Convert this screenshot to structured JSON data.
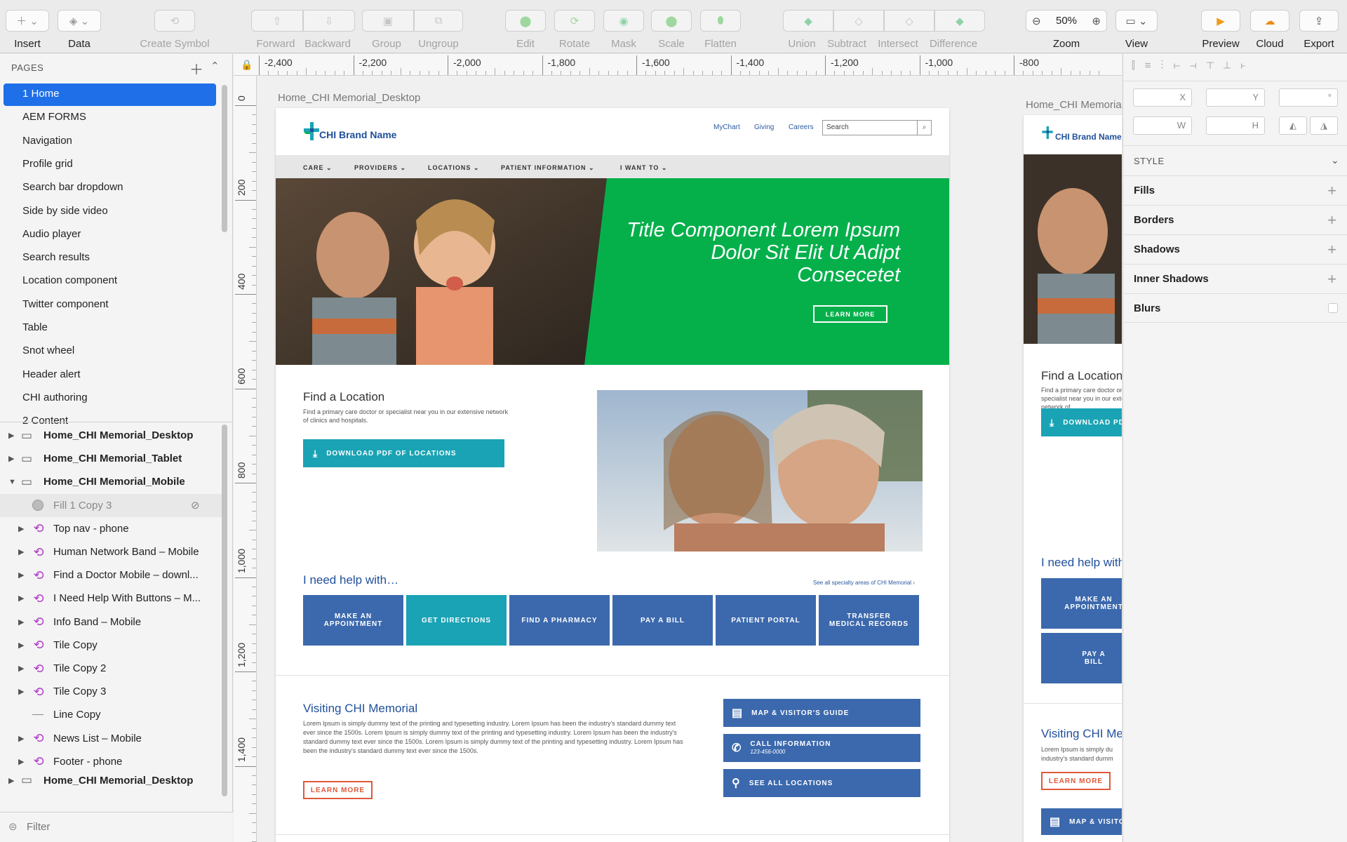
{
  "toolbar": {
    "items": [
      "Insert",
      "Data",
      "Create Symbol",
      "Forward",
      "Backward",
      "Group",
      "Ungroup",
      "Edit",
      "Rotate",
      "Mask",
      "Scale",
      "Flatten",
      "Union",
      "Subtract",
      "Intersect",
      "Difference",
      "Zoom",
      "View",
      "Preview",
      "Cloud",
      "Export"
    ],
    "zoom_value": "50%"
  },
  "pages": {
    "header": "PAGES",
    "items": [
      "1 Home",
      "AEM FORMS",
      "Navigation",
      "Profile grid",
      "Search bar dropdown",
      "Side by side video",
      "Audio player",
      "Search results",
      "Location component",
      "Twitter component",
      "Table",
      "Snot wheel",
      "Header alert",
      "CHI authoring",
      "2 Content"
    ]
  },
  "layers": {
    "artboards": [
      "Home_CHI Memorial_Desktop",
      "Home_CHI Memorial_Tablet",
      "Home_CHI Memorial_Mobile"
    ],
    "children": [
      "Fill 1 Copy 3",
      "Top nav - phone",
      "Human Network Band – Mobile",
      "Find a Doctor Mobile – downl...",
      "I Need Help With Buttons – M...",
      "Info Band – Mobile",
      "Tile  Copy",
      "Tile  Copy 2",
      "Tile  Copy 3",
      "Line Copy",
      "News List – Mobile",
      "Footer - phone"
    ],
    "last_artboard": "Home_CHI Memorial_Desktop",
    "filter_placeholder": "Filter"
  },
  "ruler": {
    "h": [
      "-2,400",
      "-2,200",
      "-2,000",
      "-1,800",
      "-1,600",
      "-1,400",
      "-1,200",
      "-1,000",
      "-800"
    ],
    "v": [
      "0",
      "200",
      "400",
      "600",
      "800",
      "1,000",
      "1,200",
      "1,400"
    ]
  },
  "inspector": {
    "fields": [
      "X",
      "Y",
      "°",
      "W",
      "H"
    ],
    "style_label": "STYLE",
    "sections": [
      "Fills",
      "Borders",
      "Shadows",
      "Inner Shadows",
      "Blurs"
    ]
  },
  "desktop": {
    "artboard_label": "Home_CHI Memorial_Desktop",
    "brand": "CHI Brand Name",
    "util_links": [
      "MyChart",
      "Giving",
      "Careers"
    ],
    "search_placeholder": "Search",
    "nav": [
      "CARE",
      "PROVIDERS",
      "LOCATIONS",
      "PATIENT INFORMATION",
      "I WANT TO"
    ],
    "hero_title": "Title Component Lorem Ipsum Dolor Sit Elit Ut Adipt Consecetet",
    "hero_button": "LEARN MORE",
    "find_title": "Find a Location",
    "find_text": "Find a primary care doctor or specialist near you in our extensive network of clinics and hospitals.",
    "download_button": "DOWNLOAD PDF OF LOCATIONS",
    "help_title": "I need help with…",
    "help_link": "See all specialty areas of CHI Memorial",
    "help_buttons": [
      "MAKE AN APPOINTMENT",
      "GET DIRECTIONS",
      "FIND A PHARMACY",
      "PAY A BILL",
      "PATIENT PORTAL",
      "TRANSFER MEDICAL RECORDS"
    ],
    "visit_title": "Visiting CHI Memorial",
    "visit_text": "Lorem Ipsum is simply dummy text of the printing and typesetting industry. Lorem Ipsum has been the industry's standard dummy text ever since the 1500s. Lorem Ipsum is simply dummy text of the printing and typesetting industry. Lorem Ipsum has been the industry's standard dummy text ever since the 1500s. Lorem Ipsum is simply dummy text of the printing and typesetting industry. Lorem Ipsum has been the industry's standard dummy text ever since the 1500s.",
    "visit_button": "LEARN MORE",
    "side_buttons": [
      "MAP & VISITOR'S GUIDE",
      "CALL INFORMATION",
      "SEE ALL LOCATIONS"
    ],
    "call_number": "123-456-0000"
  },
  "tablet": {
    "artboard_label": "Home_CHI Memorial",
    "brand": "CHI Brand Name",
    "find_title": "Find a Location",
    "find_text": "Find a primary care doctor or specialist near you in our extensive network of",
    "download_button": "DOWNLOAD PDF",
    "help_title": "I need help with",
    "help_buttons": [
      "MAKE AN APPOINTMENT",
      "PAY A BILL"
    ],
    "visit_title": "Visiting CHI Me",
    "visit_text": "Lorem Ipsum is simply du industry's standard dumm",
    "visit_button": "LEARN MORE",
    "map_button": "MAP & VISITO"
  },
  "colors": {
    "accent": "#1a73e8",
    "green": "#05b04b",
    "blue": "#3c69ad",
    "teal": "#1aa3b4",
    "orange": "#e0593b",
    "brand": "#1f4f9b"
  }
}
